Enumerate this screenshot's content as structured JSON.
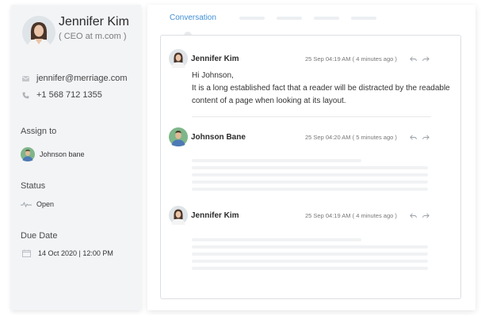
{
  "profile": {
    "name": "Jennifer Kim",
    "role": "( CEO at m.com )",
    "email": "jennifer@merriage.com",
    "phone": "+1 568 712 1355"
  },
  "assign": {
    "label": "Assign to",
    "assignee": "Johnson bane"
  },
  "status": {
    "label": "Status",
    "value": "Open"
  },
  "due": {
    "label": "Due Date",
    "value": "14 Oct 2020 | 12:00 PM"
  },
  "tabs": {
    "active": "Conversation"
  },
  "messages": [
    {
      "author": "Jennifer Kim",
      "time": "25 Sep 04:19 AM ( 4 minutes ago )",
      "greeting": "Hi Johnson,",
      "line1": "It is a long established fact that a reader will be distracted by the readable",
      "line2": "content of a page when looking at its layout."
    },
    {
      "author": "Johnson Bane",
      "time": "25 Sep 04:20 AM ( 5 minutes ago )"
    },
    {
      "author": "Jennifer Kim",
      "time": "25 Sep 04:19 AM ( 4 minutes ago )"
    }
  ],
  "colors": {
    "accent": "#3f8fd8",
    "panel_bg": "#f3f4f6",
    "skeleton": "#f0f2f4"
  },
  "icons": [
    "mail-icon",
    "phone-icon",
    "pulse-icon",
    "calendar-icon",
    "reply-icon",
    "forward-icon"
  ]
}
